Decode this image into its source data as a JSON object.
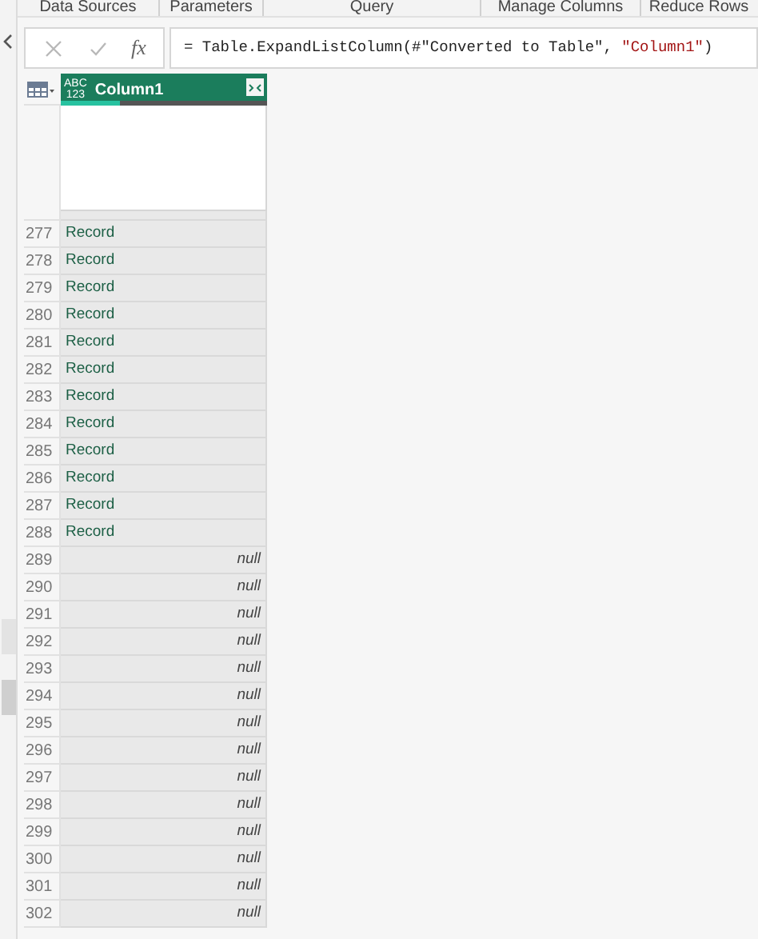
{
  "ribbon_groups": [
    {
      "label": "Data Sources"
    },
    {
      "label": "Parameters"
    },
    {
      "label": "Query"
    },
    {
      "label": "Manage Columns"
    },
    {
      "label": "Reduce Rows"
    }
  ],
  "formula_bar": {
    "fx": "fx",
    "formula": [
      {
        "kind": "code",
        "text": "= Table.ExpandListColumn(#\"Converted to Table\", "
      },
      {
        "kind": "string",
        "text": "\"Column1\""
      },
      {
        "kind": "code",
        "text": ")"
      }
    ]
  },
  "table": {
    "columns": [
      {
        "type": "ABC\n123",
        "name": "Column1",
        "level": 0.29
      }
    ],
    "rows": [
      {
        "number": "277",
        "value": "Record",
        "kind": "record"
      },
      {
        "number": "278",
        "value": "Record",
        "kind": "record"
      },
      {
        "number": "279",
        "value": "Record",
        "kind": "record"
      },
      {
        "number": "280",
        "value": "Record",
        "kind": "record"
      },
      {
        "number": "281",
        "value": "Record",
        "kind": "record"
      },
      {
        "number": "282",
        "value": "Record",
        "kind": "record"
      },
      {
        "number": "283",
        "value": "Record",
        "kind": "record"
      },
      {
        "number": "284",
        "value": "Record",
        "kind": "record"
      },
      {
        "number": "285",
        "value": "Record",
        "kind": "record"
      },
      {
        "number": "286",
        "value": "Record",
        "kind": "record"
      },
      {
        "number": "287",
        "value": "Record",
        "kind": "record"
      },
      {
        "number": "288",
        "value": "Record",
        "kind": "record"
      },
      {
        "number": "289",
        "value": "null",
        "kind": "null"
      },
      {
        "number": "290",
        "value": "null",
        "kind": "null"
      },
      {
        "number": "291",
        "value": "null",
        "kind": "null"
      },
      {
        "number": "292",
        "value": "null",
        "kind": "null"
      },
      {
        "number": "293",
        "value": "null",
        "kind": "null"
      },
      {
        "number": "294",
        "value": "null",
        "kind": "null"
      },
      {
        "number": "295",
        "value": "null",
        "kind": "null"
      },
      {
        "number": "296",
        "value": "null",
        "kind": "null"
      },
      {
        "number": "297",
        "value": "null",
        "kind": "null"
      },
      {
        "number": "298",
        "value": "null",
        "kind": "null"
      },
      {
        "number": "299",
        "value": "null",
        "kind": "null"
      },
      {
        "number": "300",
        "value": "null",
        "kind": "null"
      },
      {
        "number": "301",
        "value": "null",
        "kind": "null"
      },
      {
        "number": "302",
        "value": "null",
        "kind": "null"
      }
    ]
  }
}
